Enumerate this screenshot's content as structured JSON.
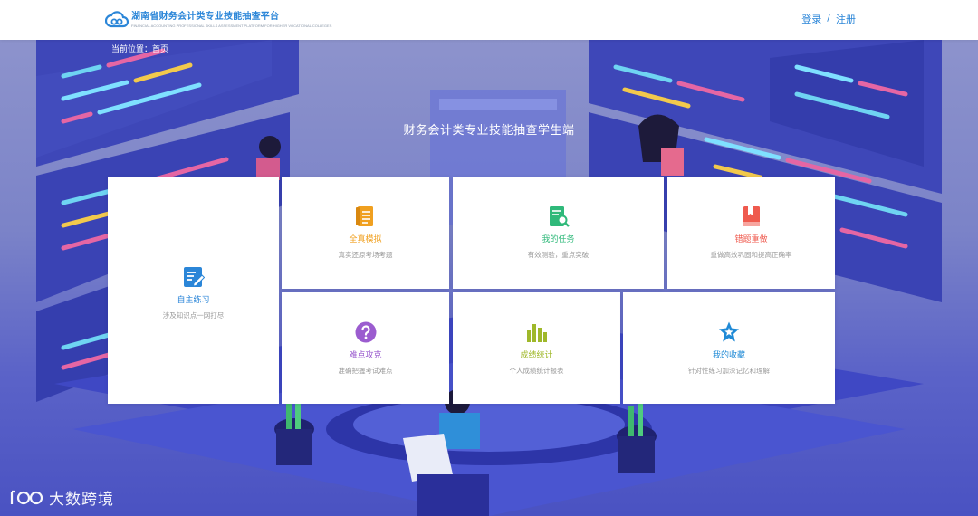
{
  "header": {
    "logo_title": "湖南省财务会计类专业技能抽查平台",
    "logo_subtitle": "FINANCIAL ACCOUNTING PROFESSIONAL SKILLS ASSESSMENT PLATFORM FOR HIGHER VOCATIONAL COLLEGES",
    "login_label": "登录",
    "separator": "/",
    "register_label": "注册"
  },
  "breadcrumb": {
    "prefix": "当前位置：",
    "current": "首页"
  },
  "page_title": "财务会计类专业技能抽查学生端",
  "cards": {
    "practice": {
      "title": "自主练习",
      "desc": "涉及知识点一网打尽",
      "icon": "edit-document-icon",
      "color": "#2b86d8"
    },
    "mock": {
      "title": "全真模拟",
      "desc": "真实还原考场考题",
      "icon": "exam-paper-icon",
      "color": "#f0a020"
    },
    "task": {
      "title": "我的任务",
      "desc": "有效测验，重点突破",
      "icon": "document-search-icon",
      "color": "#2fb97a"
    },
    "wrong": {
      "title": "错题重做",
      "desc": "重做高效巩固和提高正确率",
      "icon": "book-icon",
      "color": "#ef5a4e"
    },
    "hard": {
      "title": "难点攻克",
      "desc": "准确把握考试难点",
      "icon": "question-circle-icon",
      "color": "#9b5ccf"
    },
    "stats": {
      "title": "成绩统计",
      "desc": "个人成绩统计报表",
      "icon": "bar-chart-icon",
      "color": "#9fb82a"
    },
    "favorite": {
      "title": "我的收藏",
      "desc": "针对性练习加深记忆和理解",
      "icon": "star-badge-icon",
      "color": "#1f8ad6"
    }
  },
  "watermark": "大数跨境"
}
